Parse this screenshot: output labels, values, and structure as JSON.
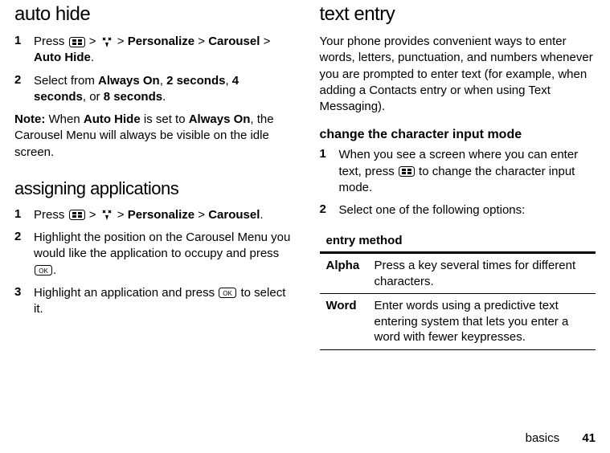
{
  "left": {
    "h1": "auto hide",
    "step1": {
      "n": "1",
      "pre": "Press ",
      "mid1": " > ",
      "mid2": " > ",
      "personalize": "Personalize",
      "g1": " > ",
      "carousel": "Carousel",
      "g2": " > ",
      "autohide": "Auto Hide",
      "dot": "."
    },
    "step2": {
      "n": "2",
      "pre": "Select from ",
      "ao": "Always On",
      "c1": ", ",
      "s2": "2 seconds",
      "c2": ", ",
      "s4": "4 seconds",
      "c3": ", or ",
      "s8": "8 seconds",
      "dot": "."
    },
    "note": {
      "label": "Note:",
      "t1": " When ",
      "ah": "Auto Hide",
      "t2": " is set to ",
      "ao": "Always On",
      "t3": ", the Carousel Menu will always be visible on the idle screen."
    },
    "h2": "assigning applications",
    "astep1": {
      "n": "1",
      "pre": "Press ",
      "mid1": " > ",
      "mid2": " > ",
      "personalize": "Personalize",
      "g1": " > ",
      "carousel": "Carousel",
      "dot": "."
    },
    "astep2": {
      "n": "2",
      "t1": "Highlight the position on the Carousel Menu you would like the application to occupy and press ",
      "dot": "."
    },
    "astep3": {
      "n": "3",
      "t1": "Highlight an application and press ",
      "t2": " to select it."
    }
  },
  "right": {
    "h1": "text entry",
    "intro": "Your phone provides convenient ways to enter words, letters, punctuation, and numbers whenever you are prompted to enter text (for example, when adding a Contacts entry or when using Text Messaging).",
    "h3": "change the character input mode",
    "rstep1": {
      "n": "1",
      "t1": "When you see a screen where you can enter text, press ",
      "t2": " to change the character input mode."
    },
    "rstep2": {
      "n": "2",
      "t": "Select one of the following options:"
    },
    "table": {
      "header": "entry method",
      "rows": [
        {
          "name": "Alpha",
          "desc": "Press a key several times for different characters."
        },
        {
          "name": "Word",
          "desc": "Enter words using a predictive text entering system that lets you enter a word with fewer keypresses."
        }
      ]
    }
  },
  "footer": {
    "section": "basics",
    "page": "41"
  }
}
